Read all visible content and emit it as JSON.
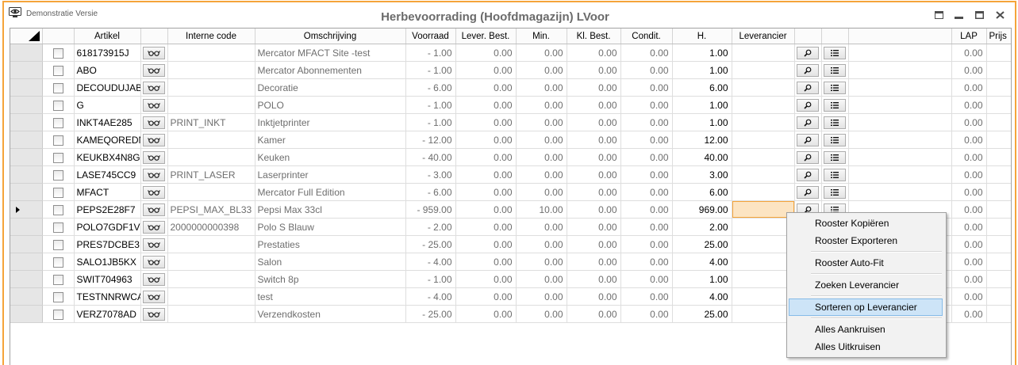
{
  "window": {
    "edition_label": "Demonstratie Versie",
    "title": "Herbevoorrading (Hoofdmagazijn) LVoor"
  },
  "icons": {
    "app": "eye-icon",
    "window_controls": [
      "window-icon",
      "minimize-icon",
      "maximize-icon",
      "close-icon"
    ],
    "row_buttons": [
      "glasses-icon",
      "search-icon",
      "list-icon"
    ],
    "select_all_corner": "corner-triangle-icon",
    "current_row_marker": "current-row-arrow-icon"
  },
  "colors": {
    "window_accent": "#f5a43a",
    "current_cell_fill": "#fce4c2",
    "menu_highlight": "#cde4f7"
  },
  "grid": {
    "headers": {
      "artikel": "Artikel",
      "interne_code": "Interne code",
      "omschrijving": "Omschrijving",
      "voorraad": "Voorraad",
      "lever_best": "Lever. Best.",
      "min": "Min.",
      "kl_best": "Kl. Best.",
      "condit": "Condit.",
      "h": "H.",
      "leverancier": "Leverancier",
      "lap": "LAP",
      "prijs": "Prijs"
    },
    "current_row_index": 9,
    "current_column": "leverancier",
    "rows": [
      {
        "checked": false,
        "artikel": "618173915J",
        "interne_code": "",
        "omschrijving": "Mercator MFACT Site -test",
        "voorraad": "- 1.00",
        "lever_best": "0.00",
        "min": "0.00",
        "kl_best": "0.00",
        "condit": "0.00",
        "h": "1.00",
        "lap": "0.00"
      },
      {
        "checked": false,
        "artikel": "ABO",
        "interne_code": "",
        "omschrijving": "Mercator Abonnementen",
        "voorraad": "- 1.00",
        "lever_best": "0.00",
        "min": "0.00",
        "kl_best": "0.00",
        "condit": "0.00",
        "h": "1.00",
        "lap": "0.00"
      },
      {
        "checked": false,
        "artikel": "DECOUDUJAB",
        "interne_code": "",
        "omschrijving": "Decoratie",
        "voorraad": "- 6.00",
        "lever_best": "0.00",
        "min": "0.00",
        "kl_best": "0.00",
        "condit": "0.00",
        "h": "6.00",
        "lap": "0.00"
      },
      {
        "checked": false,
        "artikel": "G",
        "interne_code": "",
        "omschrijving": "POLO",
        "voorraad": "- 1.00",
        "lever_best": "0.00",
        "min": "0.00",
        "kl_best": "0.00",
        "condit": "0.00",
        "h": "1.00",
        "lap": "0.00"
      },
      {
        "checked": false,
        "artikel": "INKT4AE285",
        "interne_code": "PRINT_INKT",
        "omschrijving": "Inktjetprinter",
        "voorraad": "- 1.00",
        "lever_best": "0.00",
        "min": "0.00",
        "kl_best": "0.00",
        "condit": "0.00",
        "h": "1.00",
        "lap": "0.00"
      },
      {
        "checked": false,
        "artikel": "KAMEQOREDN",
        "interne_code": "",
        "omschrijving": "Kamer",
        "voorraad": "- 12.00",
        "lever_best": "0.00",
        "min": "0.00",
        "kl_best": "0.00",
        "condit": "0.00",
        "h": "12.00",
        "lap": "0.00"
      },
      {
        "checked": false,
        "artikel": "KEUKBX4N8G",
        "interne_code": "",
        "omschrijving": "Keuken",
        "voorraad": "- 40.00",
        "lever_best": "0.00",
        "min": "0.00",
        "kl_best": "0.00",
        "condit": "0.00",
        "h": "40.00",
        "lap": "0.00"
      },
      {
        "checked": false,
        "artikel": "LASE745CC9",
        "interne_code": "PRINT_LASER",
        "omschrijving": "Laserprinter",
        "voorraad": "- 3.00",
        "lever_best": "0.00",
        "min": "0.00",
        "kl_best": "0.00",
        "condit": "0.00",
        "h": "3.00",
        "lap": "0.00"
      },
      {
        "checked": false,
        "artikel": "MFACT",
        "interne_code": "",
        "omschrijving": "Mercator Full Edition",
        "voorraad": "- 6.00",
        "lever_best": "0.00",
        "min": "0.00",
        "kl_best": "0.00",
        "condit": "0.00",
        "h": "6.00",
        "lap": "0.00"
      },
      {
        "checked": false,
        "artikel": "PEPS2E28F7",
        "interne_code": "PEPSI_MAX_BL33",
        "omschrijving": "Pepsi Max 33cl",
        "voorraad": "- 959.00",
        "lever_best": "0.00",
        "min": "10.00",
        "kl_best": "0.00",
        "condit": "0.00",
        "h": "969.00",
        "lap": "0.00"
      },
      {
        "checked": false,
        "artikel": "POLO7GDF1V",
        "interne_code": "2000000000398",
        "omschrijving": "Polo S Blauw",
        "voorraad": "- 2.00",
        "lever_best": "0.00",
        "min": "0.00",
        "kl_best": "0.00",
        "condit": "0.00",
        "h": "2.00",
        "lap": "0.00"
      },
      {
        "checked": false,
        "artikel": "PRES7DCBE3",
        "interne_code": "",
        "omschrijving": "Prestaties",
        "voorraad": "- 25.00",
        "lever_best": "0.00",
        "min": "0.00",
        "kl_best": "0.00",
        "condit": "0.00",
        "h": "25.00",
        "lap": "0.00"
      },
      {
        "checked": false,
        "artikel": "SALO1JB5KX",
        "interne_code": "",
        "omschrijving": "Salon",
        "voorraad": "- 4.00",
        "lever_best": "0.00",
        "min": "0.00",
        "kl_best": "0.00",
        "condit": "0.00",
        "h": "4.00",
        "lap": "0.00"
      },
      {
        "checked": false,
        "artikel": "SWIT704963",
        "interne_code": "",
        "omschrijving": "Switch 8p",
        "voorraad": "- 1.00",
        "lever_best": "0.00",
        "min": "0.00",
        "kl_best": "0.00",
        "condit": "0.00",
        "h": "1.00",
        "lap": "0.00"
      },
      {
        "checked": false,
        "artikel": "TESTNNRWCA",
        "interne_code": "",
        "omschrijving": "test",
        "voorraad": "- 4.00",
        "lever_best": "0.00",
        "min": "0.00",
        "kl_best": "0.00",
        "condit": "0.00",
        "h": "4.00",
        "lap": "0.00"
      },
      {
        "checked": false,
        "artikel": "VERZ7078AD",
        "interne_code": "",
        "omschrijving": "Verzendkosten",
        "voorraad": "- 25.00",
        "lever_best": "0.00",
        "min": "0.00",
        "kl_best": "0.00",
        "condit": "0.00",
        "h": "25.00",
        "lap": "0.00"
      }
    ]
  },
  "context_menu": {
    "items": [
      "Rooster Kopiëren",
      "Rooster Exporteren",
      "Rooster Auto-Fit",
      "Zoeken Leverancier",
      "Sorteren op Leverancier",
      "Alles Aankruisen",
      "Alles Uitkruisen"
    ],
    "highlighted_index": 4
  }
}
